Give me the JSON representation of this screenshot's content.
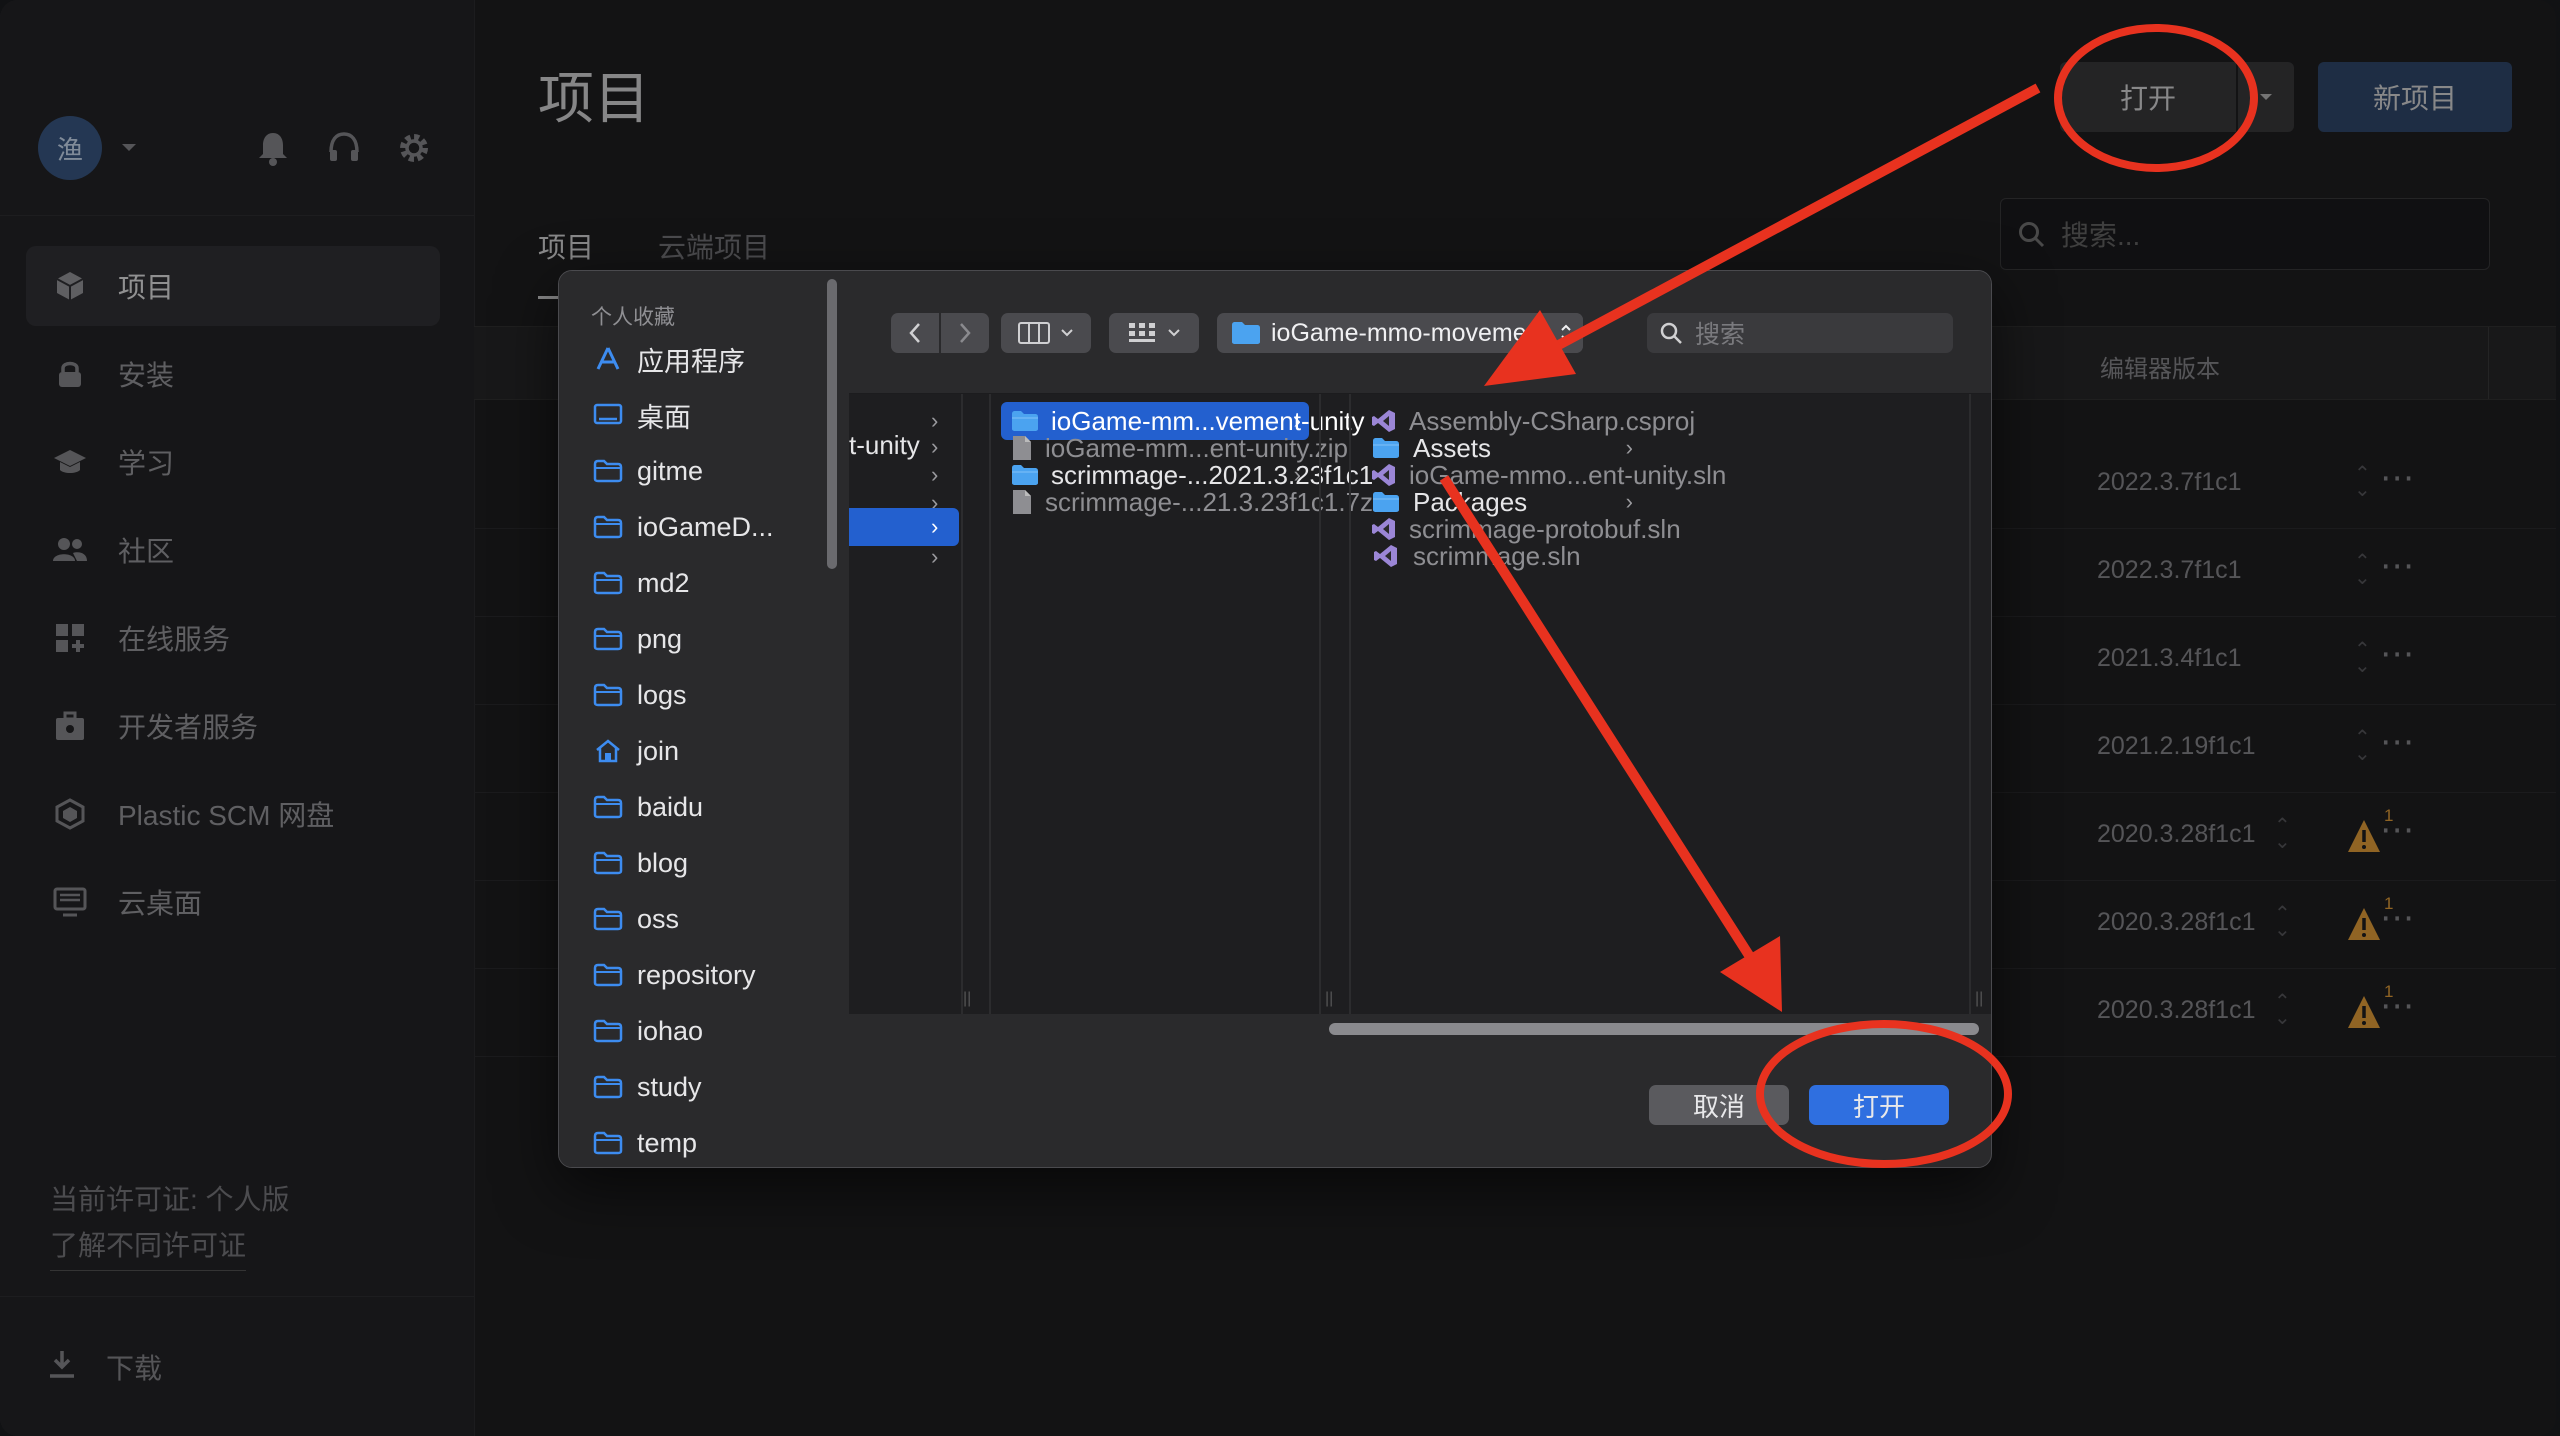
{
  "app": {
    "user_initial": "渔",
    "sidebar": {
      "items": [
        {
          "label": "项目"
        },
        {
          "label": "安装"
        },
        {
          "label": "学习"
        },
        {
          "label": "社区"
        },
        {
          "label": "在线服务"
        },
        {
          "label": "开发者服务"
        },
        {
          "label": "Plastic SCM 网盘"
        },
        {
          "label": "云桌面"
        }
      ],
      "license_text": "当前许可证: 个人版",
      "license_link": "了解不同许可证",
      "download": "下载"
    },
    "main": {
      "title": "项目",
      "open_button": "打开",
      "new_project_button": "新项目",
      "tabs": [
        "项目",
        "云端项目"
      ],
      "search_placeholder": "搜索...",
      "column_editor_version": "编辑器版本",
      "rows": [
        {
          "version": "2022.3.7f1c1",
          "warning": false
        },
        {
          "version": "2022.3.7f1c1",
          "warning": false
        },
        {
          "version": "2021.3.4f1c1",
          "warning": false
        },
        {
          "version": "2021.2.19f1c1",
          "warning": false
        },
        {
          "version": "2020.3.28f1c1",
          "warning": true,
          "warning_count": "1"
        },
        {
          "version": "2020.3.28f1c1",
          "warning": true,
          "warning_count": "1"
        },
        {
          "version": "2020.3.28f1c1",
          "warning": true,
          "warning_count": "1"
        }
      ]
    }
  },
  "dialog": {
    "favorites_header": "个人收藏",
    "favorites": [
      {
        "label": "应用程序",
        "icon": "apps-icon"
      },
      {
        "label": "桌面",
        "icon": "desktop-icon"
      },
      {
        "label": "gitme",
        "icon": "folder-icon"
      },
      {
        "label": "ioGameD...",
        "icon": "folder-icon"
      },
      {
        "label": "md2",
        "icon": "folder-icon"
      },
      {
        "label": "png",
        "icon": "folder-icon"
      },
      {
        "label": "logs",
        "icon": "folder-icon"
      },
      {
        "label": "join",
        "icon": "home-icon"
      },
      {
        "label": "baidu",
        "icon": "folder-icon"
      },
      {
        "label": "blog",
        "icon": "folder-icon"
      },
      {
        "label": "oss",
        "icon": "folder-icon"
      },
      {
        "label": "repository",
        "icon": "folder-icon"
      },
      {
        "label": "iohao",
        "icon": "folder-icon"
      },
      {
        "label": "study",
        "icon": "folder-icon"
      },
      {
        "label": "temp",
        "icon": "folder-icon"
      }
    ],
    "path_label": "ioGame-mmo-movement-unity",
    "search_placeholder": "搜索",
    "column1_partial": "t-unity",
    "column2": [
      {
        "name": "ioGame-mm...vement-unity",
        "type": "folder",
        "selected": true
      },
      {
        "name": "ioGame-mm...ent-unity.zip",
        "type": "file"
      },
      {
        "name": "scrimmage-...2021.3.23f1c1",
        "type": "folder"
      },
      {
        "name": "scrimmage-...21.3.23f1c1.7z",
        "type": "file"
      }
    ],
    "column3": [
      {
        "name": "Assembly-CSharp.csproj",
        "type": "vs"
      },
      {
        "name": "Assets",
        "type": "folder"
      },
      {
        "name": "ioGame-mmo...ent-unity.sln",
        "type": "vs"
      },
      {
        "name": "Packages",
        "type": "folder"
      },
      {
        "name": "scrimmage-protobuf.sln",
        "type": "vs"
      },
      {
        "name": "scrimmage.sln",
        "type": "vs"
      }
    ],
    "cancel_button": "取消",
    "open_button": "打开"
  },
  "colors": {
    "accent_blue": "#2360cf",
    "annotation_red": "#e8321f",
    "warning_orange": "#e8a23b"
  }
}
